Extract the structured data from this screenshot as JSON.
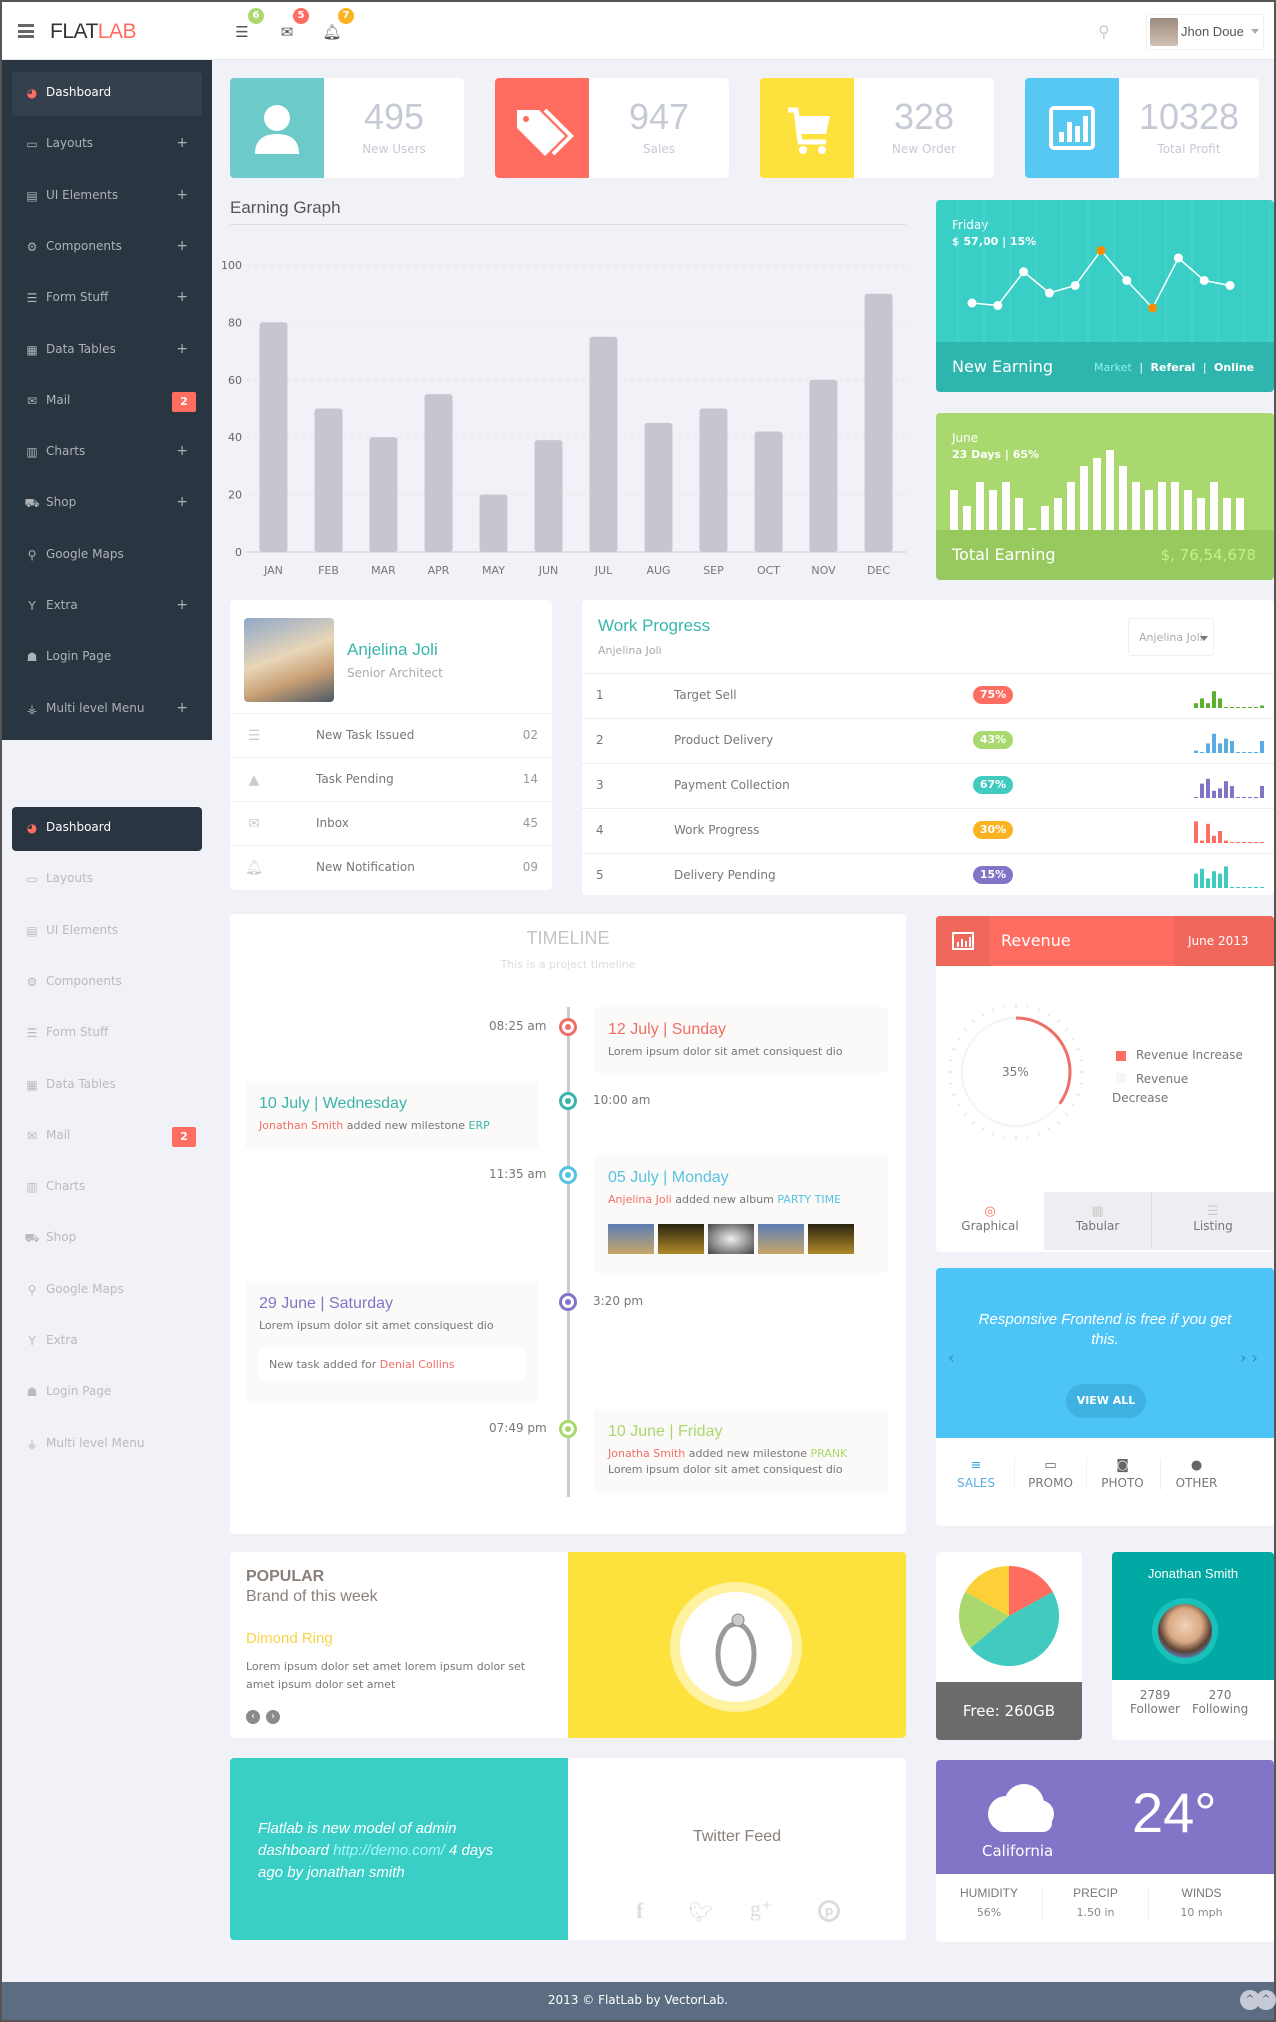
{
  "header": {
    "logo_main": "FLAT",
    "logo_accent": "LAB",
    "notifications": [
      {
        "icon": "tasks-icon",
        "count": "6",
        "color": "#a9d86e"
      },
      {
        "icon": "envelope-icon",
        "count": "5",
        "color": "#ff6c60"
      },
      {
        "icon": "bell-icon",
        "count": "7",
        "color": "#fcb322"
      }
    ],
    "user_name": "Jhon Doue"
  },
  "sidebar": {
    "items": [
      {
        "label": "Dashboard",
        "icon": "dashboard-icon",
        "active": true
      },
      {
        "label": "Layouts",
        "icon": "laptop-icon",
        "expand": "+"
      },
      {
        "label": "UI Elements",
        "icon": "book-icon",
        "expand": "+"
      },
      {
        "label": "Components",
        "icon": "cogs-icon",
        "expand": "+"
      },
      {
        "label": "Form Stuff",
        "icon": "tasks-icon",
        "expand": "+"
      },
      {
        "label": "Data Tables",
        "icon": "table-icon",
        "expand": "+"
      },
      {
        "label": "Mail",
        "icon": "envelope-icon",
        "badge": "2"
      },
      {
        "label": "Charts",
        "icon": "bar-chart-icon",
        "expand": "+"
      },
      {
        "label": "Shop",
        "icon": "shopping-cart-icon",
        "expand": "+"
      },
      {
        "label": "Google Maps",
        "icon": "map-marker-icon"
      },
      {
        "label": "Extra",
        "icon": "glass-icon",
        "expand": "+"
      },
      {
        "label": "Login Page",
        "icon": "user-icon"
      },
      {
        "label": "Multi level Menu",
        "icon": "sitemap-icon",
        "expand": "+"
      }
    ]
  },
  "stats": [
    {
      "value": "495",
      "label": "New Users",
      "color": "#6ccac9",
      "icon": "user-icon"
    },
    {
      "value": "947",
      "label": "Sales",
      "color": "#ff6c60",
      "icon": "tags-icon"
    },
    {
      "value": "328",
      "label": "New Order",
      "color": "#f8d347",
      "icon": "shopping-cart-icon"
    },
    {
      "value": "10328",
      "label": "Total Profit",
      "color": "#57c8f2",
      "icon": "bar-chart-icon"
    }
  ],
  "earning_graph": {
    "title": "Earning Graph"
  },
  "chart_data": {
    "type": "bar",
    "title": "Earning Graph",
    "categories": [
      "JAN",
      "FEB",
      "MAR",
      "APR",
      "MAY",
      "JUN",
      "JUL",
      "AUG",
      "SEP",
      "OCT",
      "NOV",
      "DEC"
    ],
    "values": [
      80,
      50,
      40,
      55,
      20,
      39,
      75,
      45,
      50,
      42,
      60,
      90
    ],
    "yticks": [
      0,
      20,
      40,
      60,
      80,
      100
    ],
    "ylim": [
      0,
      100
    ],
    "xlabel": "",
    "ylabel": "",
    "grid": true,
    "color": "#c7c6d0"
  },
  "new_earning": {
    "day": "Friday",
    "summary": "$ 57,00 | 15%",
    "title": "New Earning",
    "links": [
      "Market",
      "Referal",
      "Online"
    ],
    "sparkline": [
      20,
      18,
      45,
      28,
      34,
      62,
      38,
      16,
      56,
      38,
      34
    ],
    "highlight": [
      5,
      7
    ]
  },
  "total_earning": {
    "month": "June",
    "summary": "23 Days | 65%",
    "title": "Total Earning",
    "value": "$, 76,54,678",
    "bars": [
      5,
      3,
      6,
      5,
      6,
      4,
      0,
      3,
      4,
      6,
      8,
      9,
      10,
      8,
      6,
      5,
      6,
      6,
      5,
      4,
      6,
      4,
      4
    ]
  },
  "profile": {
    "name": "Anjelina Joli",
    "role": "Senior Architect",
    "rows": [
      {
        "icon": "tasks-icon",
        "label": "New Task Issued",
        "value": "02"
      },
      {
        "icon": "warning-icon",
        "label": "Task Pending",
        "value": "14"
      },
      {
        "icon": "envelope-icon",
        "label": "Inbox",
        "value": "45"
      },
      {
        "icon": "bell-icon",
        "label": "New Notification",
        "value": "09"
      }
    ]
  },
  "work_progress": {
    "title": "Work Progress",
    "subtitle": "Anjelina Joli",
    "select_value": "Anjelina Joli",
    "rows": [
      {
        "n": "1",
        "task": "Target Sell",
        "pct": "75%",
        "color": "#ff6c60",
        "spark_color": "#5bb12f",
        "spark": [
          2,
          4,
          2,
          7,
          4,
          0,
          0,
          0,
          0,
          0,
          0,
          1
        ]
      },
      {
        "n": "2",
        "task": "Product Delivery",
        "pct": "43%",
        "color": "#a9d86e",
        "spark_color": "#59ace2",
        "spark": [
          1,
          0,
          4,
          8,
          4,
          6,
          5,
          0,
          0,
          0,
          0,
          5
        ]
      },
      {
        "n": "3",
        "task": "Payment Collection",
        "pct": "67%",
        "color": "#41cac0",
        "spark_color": "#8075c4",
        "spark": [
          0,
          6,
          8,
          3,
          4,
          7,
          5,
          0,
          0,
          0,
          0,
          5
        ]
      },
      {
        "n": "4",
        "task": "Work Progress",
        "pct": "30%",
        "color": "#fcb322",
        "spark_color": "#ff6c60",
        "spark": [
          9,
          1,
          8,
          3,
          5,
          1,
          0,
          0,
          0,
          0,
          0,
          0
        ]
      },
      {
        "n": "5",
        "task": "Delivery Pending",
        "pct": "15%",
        "color": "#8175c7",
        "spark_color": "#41cac0",
        "spark": [
          6,
          8,
          4,
          7,
          6,
          9,
          0,
          0,
          0,
          0,
          0,
          0
        ]
      }
    ]
  },
  "timeline": {
    "title": "TIMELINE",
    "subtitle": "This is a project timeline",
    "events": [
      {
        "time": "08:25 am",
        "date": "12 July | Sunday",
        "color": "#ef6f66",
        "text": "Lorem ipsum dolor sit amet consiquest dio"
      },
      {
        "time": "10:00 am",
        "date": "10 July | Wednesday",
        "color": "#39b6ac",
        "person": "Jonathan Smith",
        "action": " added new milestone ",
        "target": "ERP"
      },
      {
        "time": "11:35 am",
        "date": "05 July | Monday",
        "color": "#56c2e1",
        "person": "Anjelina Joli",
        "action": " added new album ",
        "target": "PARTY TIME",
        "photos": 5
      },
      {
        "time": "3:20 pm",
        "date": "29 June | Saturday",
        "color": "#8175c7",
        "text": "Lorem ipsum dolor sit amet consiquest dio",
        "note_prefix": "New task added for ",
        "note_person": "Denial Collins"
      },
      {
        "time": "07:49 pm",
        "date": "10 June | Friday",
        "color": "#a9d86e",
        "person": "Jonatha Smith",
        "action": " added new milestone ",
        "target": "PRANK",
        "text": "Lorem ipsum dolor sit amet consiquest dio"
      }
    ]
  },
  "revenue": {
    "title": "Revenue",
    "period": "June 2013",
    "percent_label": "35%",
    "percent": 35,
    "legend": [
      "Revenue Increase",
      "Revenue Decrease"
    ],
    "tabs": [
      "Graphical",
      "Tabular",
      "Listing"
    ],
    "active_tab": "Graphical"
  },
  "promo": {
    "text": "Responsive Frontend is free if you get this.",
    "button": "VIEW ALL",
    "tabs": [
      {
        "label": "SALES",
        "icon": "list-icon"
      },
      {
        "label": "PROMO",
        "icon": "calendar-icon"
      },
      {
        "label": "PHOTO",
        "icon": "camera-icon"
      },
      {
        "label": "OTHER",
        "icon": "circle-icon"
      }
    ]
  },
  "popular": {
    "heading": "POPULAR",
    "subheading": "Brand of this week",
    "product": "Dimond Ring",
    "description": "Lorem ipsum dolor set amet lorem ipsum dolor set amet ipsum dolor set amet"
  },
  "storage": {
    "label": "Free: 260GB",
    "slices": [
      {
        "name": "red",
        "value": 17,
        "color": "#ff6c60"
      },
      {
        "name": "teal",
        "value": 47,
        "color": "#41cac0"
      },
      {
        "name": "green",
        "value": 19,
        "color": "#a9d86e"
      },
      {
        "name": "yellow",
        "value": 17,
        "color": "#fcd036"
      }
    ]
  },
  "social_profile": {
    "name": "Jonathan Smith",
    "followers": "2789",
    "followers_label": "Follower",
    "following": "270",
    "following_label": "Following"
  },
  "twitter": {
    "post_prefix": "Flatlab is new model of admin dashboard ",
    "post_link": "http://demo.com/",
    "post_suffix": " 4 days ago by jonathan smith",
    "title": "Twitter Feed",
    "icons": [
      "facebook-icon",
      "twitter-icon",
      "google-plus-icon",
      "pinterest-icon"
    ]
  },
  "weather": {
    "city": "California",
    "temp": "24°",
    "stats": [
      {
        "label": "HUMIDITY",
        "value": "56%"
      },
      {
        "label": "PRECIP",
        "value": "1.50 in"
      },
      {
        "label": "WINDS",
        "value": "10 mph"
      }
    ]
  },
  "footer": {
    "text": "2013 © FlatLab by VectorLab."
  }
}
